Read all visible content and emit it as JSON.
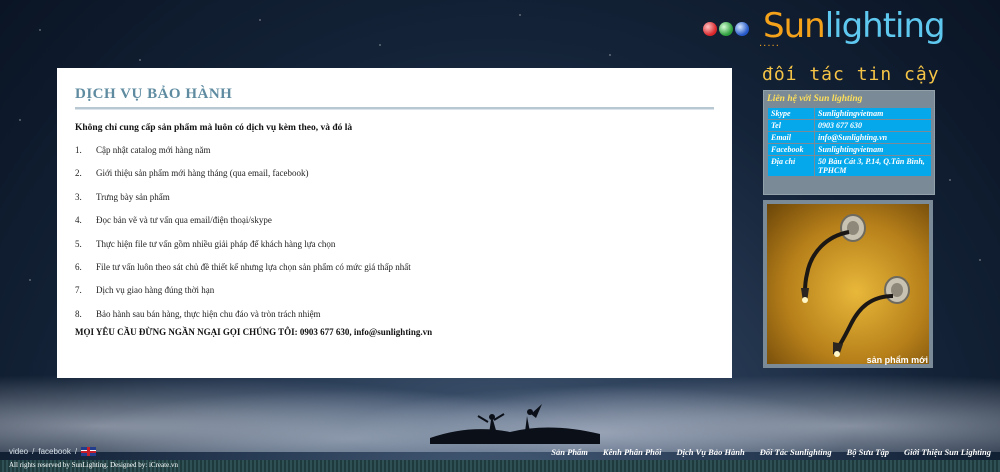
{
  "logo": {
    "brand_sun": "Sun",
    "brand_lighting": "lighting",
    "dots": "....."
  },
  "tagline": "đối tác tin cậy",
  "content": {
    "title": "DỊCH VỤ BẢO HÀNH",
    "intro": "Không chỉ cung cấp sản phẩm mà luôn có dịch vụ kèm theo, và đó là",
    "services": [
      {
        "num": "1.",
        "text": "Cập nhật catalog mới hàng năm"
      },
      {
        "num": "2.",
        "text": "Giới thiệu sản phẩm mới hàng tháng (qua email, facebook)"
      },
      {
        "num": "3.",
        "text": "Trưng bày sản phẩm"
      },
      {
        "num": "4.",
        "text": "Đọc bản vẽ và tư vấn qua email/điện thoại/skype"
      },
      {
        "num": "5.",
        "text": "Thực hiện file tư vấn gồm nhiều giải pháp để khách hàng lựa chọn"
      },
      {
        "num": "6.",
        "text": "File tư vấn luôn theo sát chủ đề thiết kế nhưng lựa chọn sản phẩm có mức giá thấp nhất"
      },
      {
        "num": "7.",
        "text": "Dịch vụ giao hàng đúng thời hạn"
      },
      {
        "num": "8.",
        "text": "Bảo hành sau bán hàng, thực hiện chu đáo và tròn trách nhiệm"
      }
    ],
    "cta": "MỌI YÊU CẦU ĐỪNG NGẦN NGẠI GỌI CHÚNG TÔI: 0903 677 630, info@sunlighting.vn"
  },
  "contact": {
    "title": "Liên hệ với Sun lighting",
    "rows": [
      {
        "key": "Skype",
        "value": "Sunlightingvietnam"
      },
      {
        "key": "Tel",
        "value": "0903 677 630"
      },
      {
        "key": "Email",
        "value": "info@Sunlighting.vn"
      },
      {
        "key": "Facebook",
        "value": "Sunlightingvietnam"
      },
      {
        "key": "Địa chỉ",
        "value": "50 Bàu Cát 3, P.14, Q.Tân Bình, TPHCM"
      }
    ]
  },
  "product": {
    "caption": "sản phẩm mới"
  },
  "footer": {
    "video": "video",
    "sep": "/",
    "facebook": "facebook",
    "nav": [
      "Sản Phẩm",
      "Kênh Phân Phối",
      "Dịch Vụ Bảo Hành",
      "Đối Tác Sunlighting",
      "Bộ Sưu Tập",
      "Giới Thiệu Sun Lighting"
    ],
    "copyright": "All rights reserved by SunLighting. Designed by: iCreate.vn"
  }
}
